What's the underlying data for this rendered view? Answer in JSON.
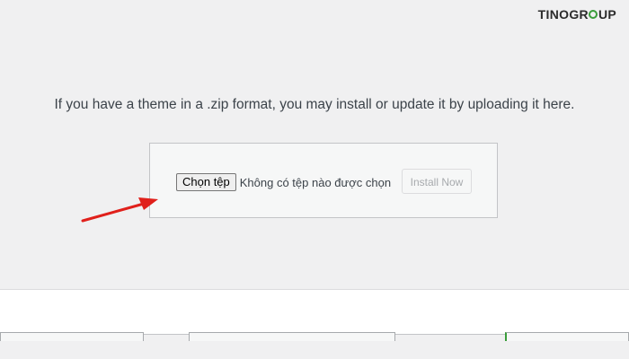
{
  "brand": {
    "logo_prefix": "TINO",
    "logo_g": "GR",
    "logo_suffix": "UP",
    "accent_color": "#3a9d3a"
  },
  "upload": {
    "intro_text": "If you have a theme in a .zip format, you may install or update it by uploading it here.",
    "choose_file_label": "Chọn tệp",
    "file_status": "Không có tệp nào được chọn",
    "install_label": "Install Now"
  },
  "annotation": {
    "arrow_color": "#e0201b"
  }
}
